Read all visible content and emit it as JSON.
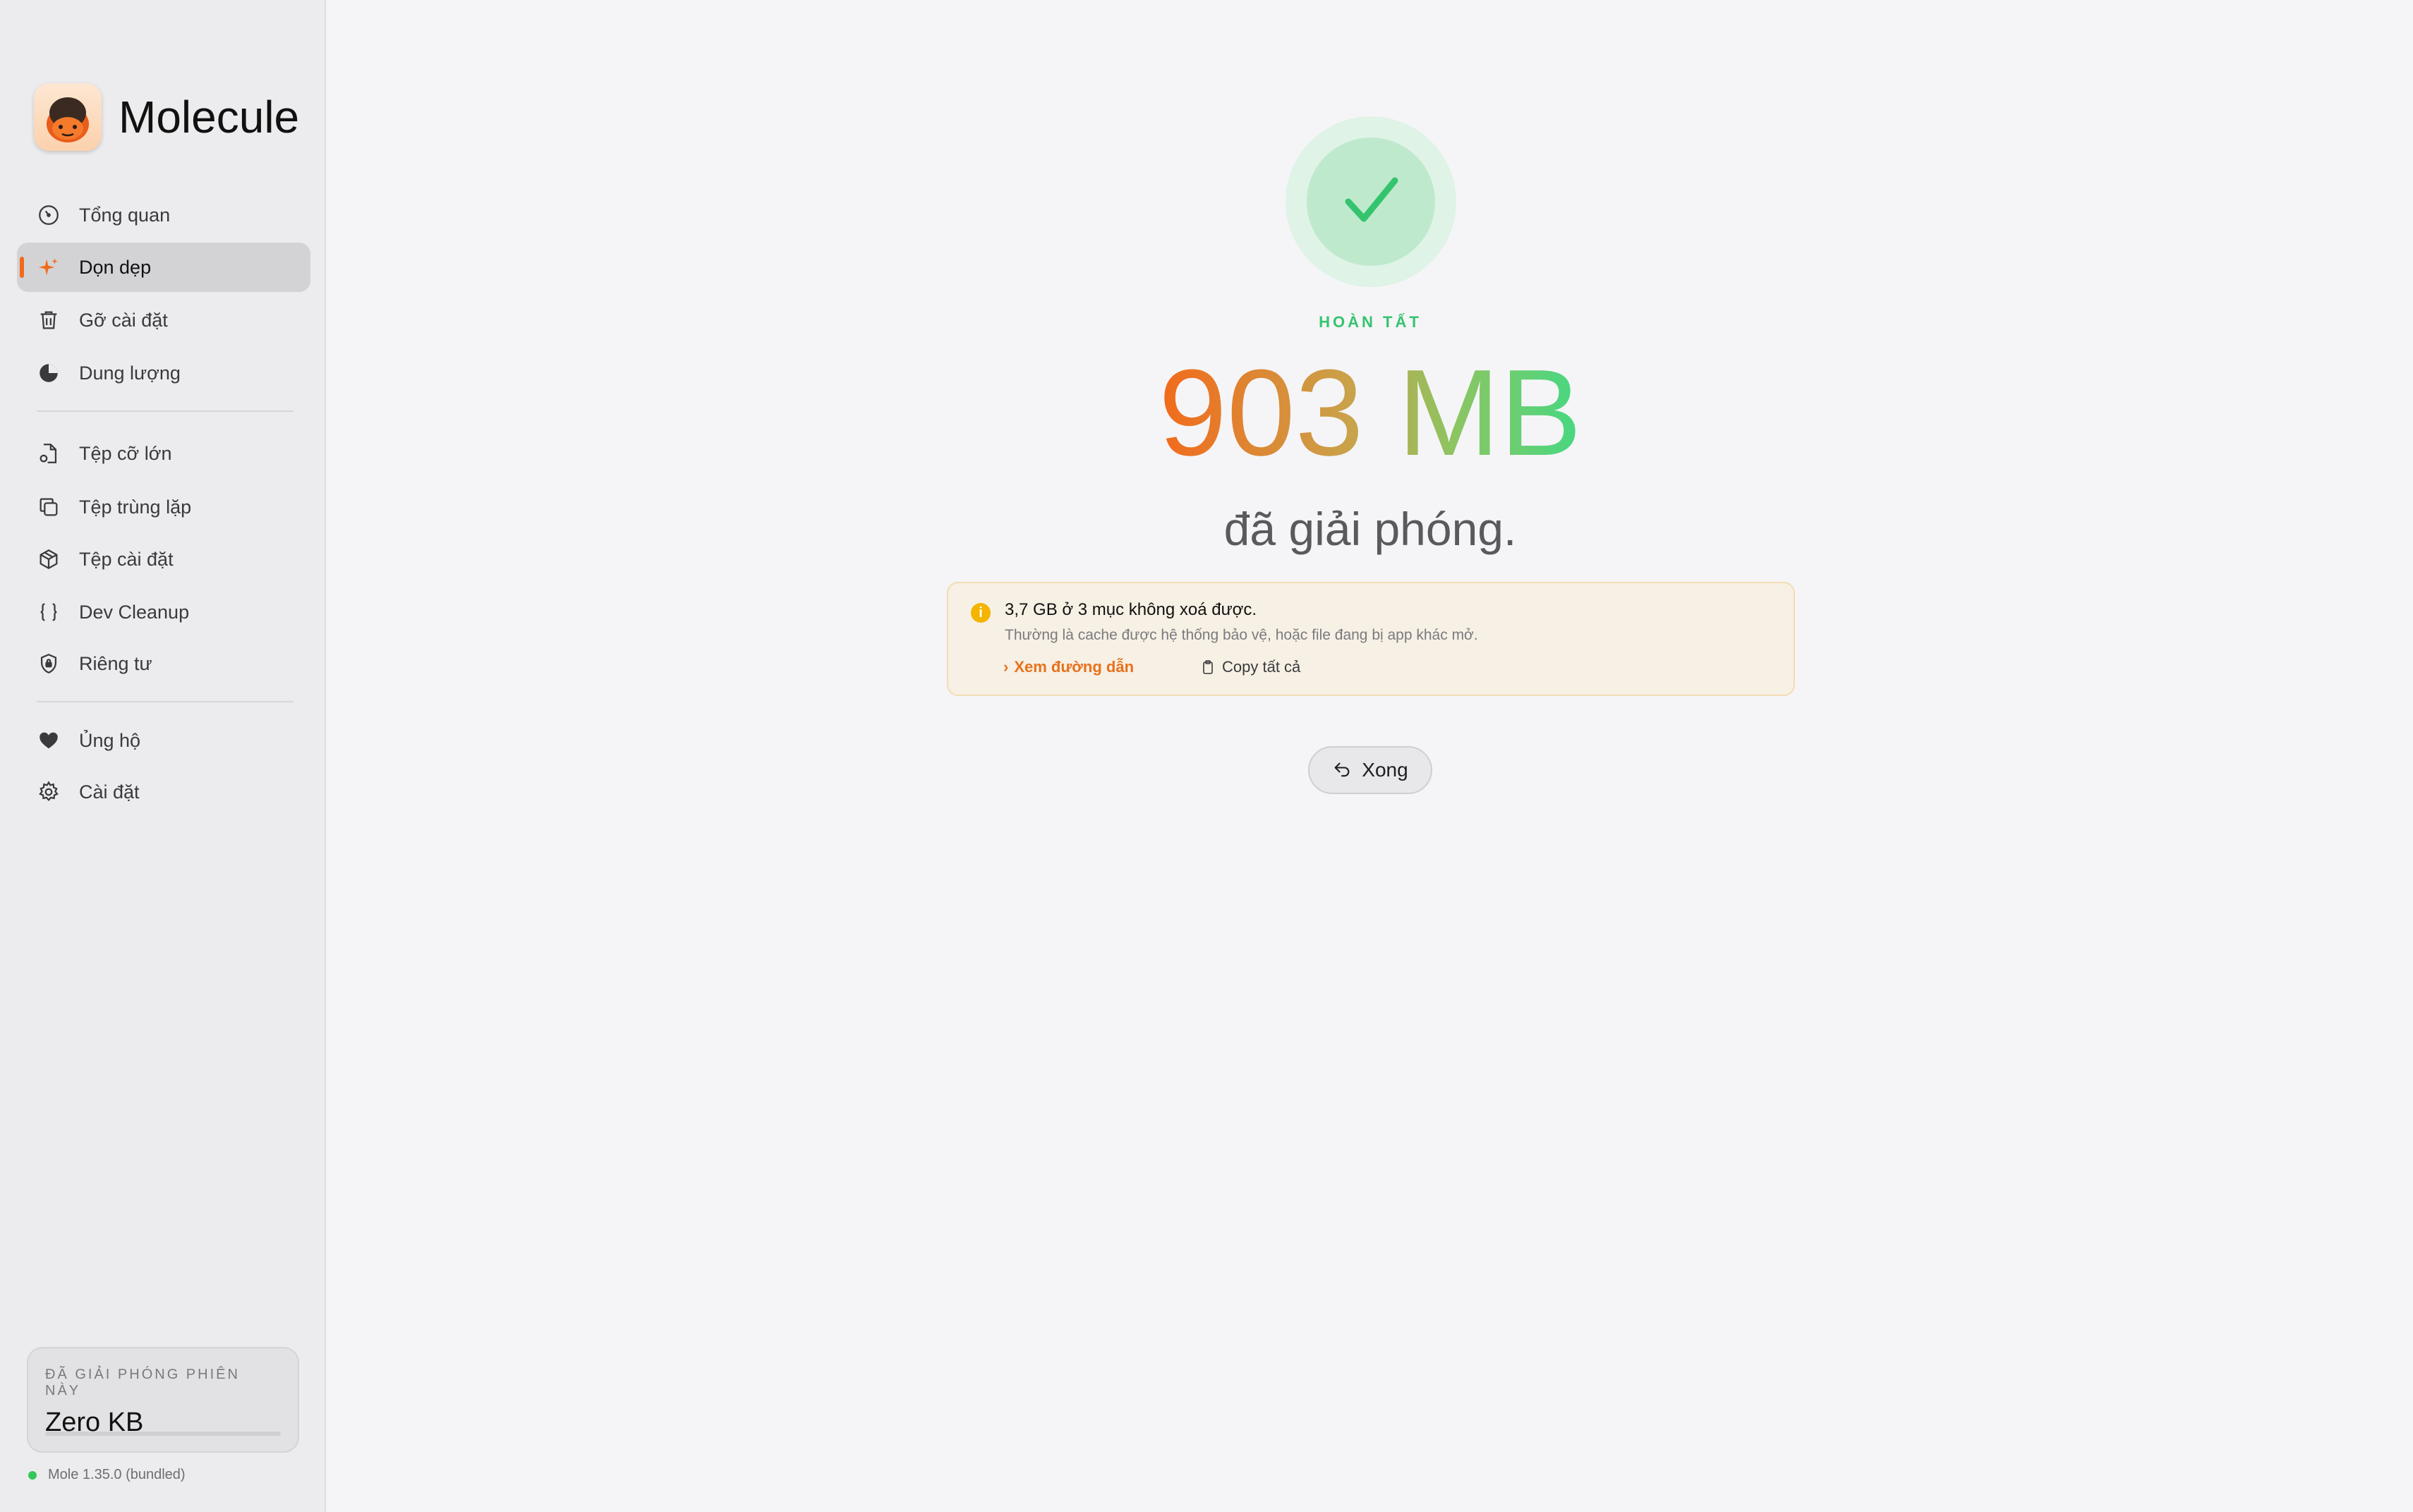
{
  "app": {
    "name": "Molecule",
    "accent_color": "#f26a1b",
    "success_color": "#34c46e"
  },
  "sidebar": {
    "items": [
      {
        "id": "overview",
        "label": "Tổng quan",
        "icon": "gauge-icon"
      },
      {
        "id": "cleanup",
        "label": "Dọn dẹp",
        "icon": "sparkle-icon",
        "active": true
      },
      {
        "id": "uninstall",
        "label": "Gỡ cài đặt",
        "icon": "trash-icon"
      },
      {
        "id": "storage",
        "label": "Dung lượng",
        "icon": "pie-chart-icon"
      },
      {
        "id": "large-files",
        "label": "Tệp cỡ lớn",
        "icon": "large-file-icon"
      },
      {
        "id": "duplicates",
        "label": "Tệp trùng lặp",
        "icon": "duplicate-icon"
      },
      {
        "id": "installers",
        "label": "Tệp cài đặt",
        "icon": "package-icon"
      },
      {
        "id": "dev-cleanup",
        "label": "Dev Cleanup",
        "icon": "braces-icon"
      },
      {
        "id": "privacy",
        "label": "Riêng tư",
        "icon": "shield-icon"
      },
      {
        "id": "support",
        "label": "Ủng hộ",
        "icon": "heart-icon"
      },
      {
        "id": "settings",
        "label": "Cài đặt",
        "icon": "gear-icon"
      }
    ],
    "freed_card": {
      "title": "ĐÃ GIẢI PHÓNG PHIÊN NÀY",
      "value": "Zero KB",
      "progress": 0
    },
    "version": "Mole 1.35.0 (bundled)"
  },
  "result": {
    "status": "HOÀN TẤT",
    "size": "903 MB",
    "subtitle": "đã giải phóng.",
    "warning": {
      "title": "3,7 GB ở 3 mục không xoá được.",
      "description": "Thường là cache được hệ thống bảo vệ, hoặc file đang bị app khác mở.",
      "view_paths_label": "Xem đường dẫn",
      "copy_all_label": "Copy tất cả"
    },
    "done_label": "Xong"
  }
}
